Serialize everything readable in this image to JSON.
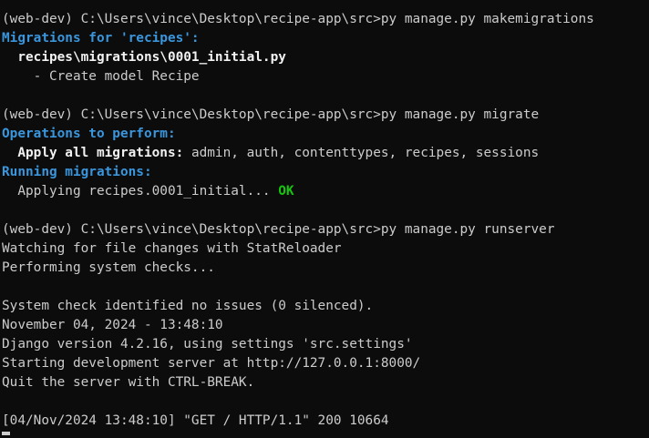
{
  "terminal": {
    "prompt": "(web-dev) C:\\Users\\vince\\Desktop\\recipe-app\\src>",
    "block1": {
      "command": "py manage.py makemigrations",
      "heading": "Migrations for 'recipes':",
      "file": "  recipes\\migrations\\0001_initial.py",
      "op": "    - Create model Recipe"
    },
    "block2": {
      "command": "py manage.py migrate",
      "heading1": "Operations to perform:",
      "apply_label": "  Apply all migrations:",
      "apply_apps": " admin, auth, contenttypes, recipes, sessions",
      "heading2": "Running migrations:",
      "applying": "  Applying recipes.0001_initial...",
      "ok": " OK"
    },
    "block3": {
      "command": "py manage.py runserver",
      "watching": "Watching for file changes with StatReloader",
      "checks": "Performing system checks...",
      "no_issues": "System check identified no issues (0 silenced).",
      "datetime": "November 04, 2024 - 13:48:10",
      "django_version": "Django version 4.2.16, using settings 'src.settings'",
      "starting": "Starting development server at http://127.0.0.1:8000/",
      "quit": "Quit the server with CTRL-BREAK.",
      "request_log": "[04/Nov/2024 13:48:10] \"GET / HTTP/1.1\" 200 10664"
    }
  }
}
